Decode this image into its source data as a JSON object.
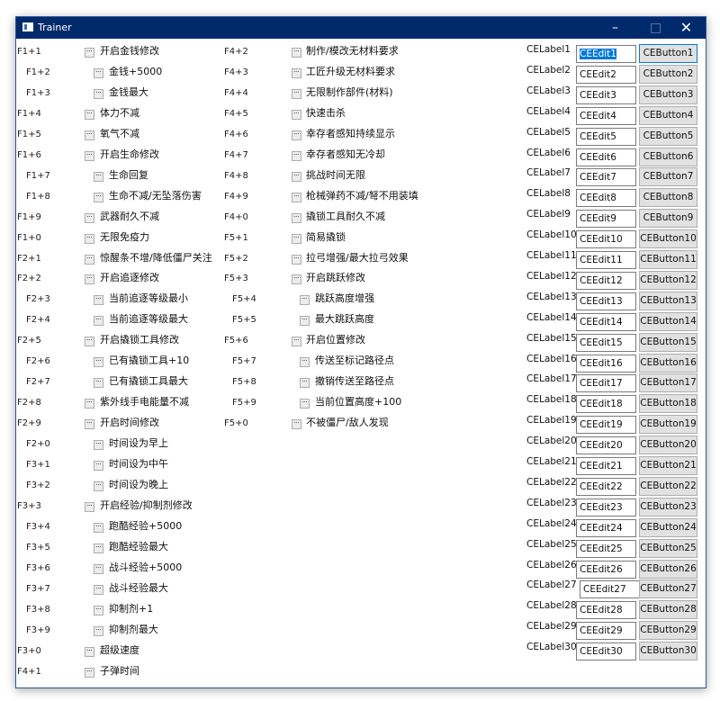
{
  "window": {
    "title": "Trainer",
    "minimize_glyph": "–",
    "maximize_glyph": "□",
    "close_glyph": "✕"
  },
  "col1": [
    {
      "hotkey": "F1+1",
      "label": "开启金钱修改",
      "sub": false
    },
    {
      "hotkey": "F1+2",
      "label": "金钱+5000",
      "sub": true
    },
    {
      "hotkey": "F1+3",
      "label": "金钱最大",
      "sub": true
    },
    {
      "hotkey": "F1+4",
      "label": "体力不减",
      "sub": false
    },
    {
      "hotkey": "F1+5",
      "label": "氧气不减",
      "sub": false
    },
    {
      "hotkey": "F1+6",
      "label": "开启生命修改",
      "sub": false
    },
    {
      "hotkey": "F1+7",
      "label": "生命回复",
      "sub": true
    },
    {
      "hotkey": "F1+8",
      "label": "生命不减/无坠落伤害",
      "sub": true
    },
    {
      "hotkey": "F1+9",
      "label": "武器耐久不减",
      "sub": false
    },
    {
      "hotkey": "F1+0",
      "label": "无限免疫力",
      "sub": false
    },
    {
      "hotkey": "F2+1",
      "label": "惊醒条不增/降低僵尸关注",
      "sub": false
    },
    {
      "hotkey": "F2+2",
      "label": "开启追逐修改",
      "sub": false
    },
    {
      "hotkey": "F2+3",
      "label": "当前追逐等级最小",
      "sub": true
    },
    {
      "hotkey": "F2+4",
      "label": "当前追逐等级最大",
      "sub": true
    },
    {
      "hotkey": "F2+5",
      "label": "开启撬锁工具修改",
      "sub": false
    },
    {
      "hotkey": "F2+6",
      "label": "已有撬锁工具+10",
      "sub": true
    },
    {
      "hotkey": "F2+7",
      "label": "已有撬锁工具最大",
      "sub": true
    },
    {
      "hotkey": "F2+8",
      "label": "紫外线手电能量不减",
      "sub": false
    },
    {
      "hotkey": "F2+9",
      "label": "开启时间修改",
      "sub": false
    },
    {
      "hotkey": "F2+0",
      "label": "时间设为早上",
      "sub": true
    },
    {
      "hotkey": "F3+1",
      "label": "时间设为中午",
      "sub": true
    },
    {
      "hotkey": "F3+2",
      "label": "时间设为晚上",
      "sub": true
    },
    {
      "hotkey": "F3+3",
      "label": "开启经验/抑制剂修改",
      "sub": false
    },
    {
      "hotkey": "F3+4",
      "label": "跑酷经验+5000",
      "sub": true
    },
    {
      "hotkey": "F3+5",
      "label": "跑酷经验最大",
      "sub": true
    },
    {
      "hotkey": "F3+6",
      "label": "战斗经验+5000",
      "sub": true
    },
    {
      "hotkey": "F3+7",
      "label": "战斗经验最大",
      "sub": true
    },
    {
      "hotkey": "F3+8",
      "label": "抑制剂+1",
      "sub": true
    },
    {
      "hotkey": "F3+9",
      "label": "抑制剂最大",
      "sub": true
    },
    {
      "hotkey": "F3+0",
      "label": "超级速度",
      "sub": false
    },
    {
      "hotkey": "F4+1",
      "label": "子弹时间",
      "sub": false
    }
  ],
  "col2": [
    {
      "hotkey": "F4+2",
      "label": "制作/模改无材料要求",
      "sub": false
    },
    {
      "hotkey": "F4+3",
      "label": "工匠升级无材料要求",
      "sub": false
    },
    {
      "hotkey": "F4+4",
      "label": "无限制作部件(材料)",
      "sub": false
    },
    {
      "hotkey": "F4+5",
      "label": "快速击杀",
      "sub": false
    },
    {
      "hotkey": "F4+6",
      "label": "幸存者感知持续显示",
      "sub": false
    },
    {
      "hotkey": "F4+7",
      "label": "幸存者感知无冷却",
      "sub": false
    },
    {
      "hotkey": "F4+8",
      "label": "挑战时间无限",
      "sub": false
    },
    {
      "hotkey": "F4+9",
      "label": "枪械弹药不减/弩不用装填",
      "sub": false
    },
    {
      "hotkey": "F4+0",
      "label": "撬锁工具耐久不减",
      "sub": false
    },
    {
      "hotkey": "F5+1",
      "label": "简易撬锁",
      "sub": false
    },
    {
      "hotkey": "F5+2",
      "label": "拉弓增强/最大拉弓效果",
      "sub": false
    },
    {
      "hotkey": "F5+3",
      "label": "开启跳跃修改",
      "sub": false
    },
    {
      "hotkey": "F5+4",
      "label": "跳跃高度增强",
      "sub": true
    },
    {
      "hotkey": "F5+5",
      "label": "最大跳跃高度",
      "sub": true
    },
    {
      "hotkey": "F5+6",
      "label": "开启位置修改",
      "sub": false
    },
    {
      "hotkey": "F5+7",
      "label": "传送至标记路径点",
      "sub": true
    },
    {
      "hotkey": "F5+8",
      "label": "撤销传送至路径点",
      "sub": true
    },
    {
      "hotkey": "F5+9",
      "label": "当前位置高度+100",
      "sub": true
    },
    {
      "hotkey": "F5+0",
      "label": "不被僵尸/敌人发现",
      "sub": false
    }
  ],
  "ce_rows": [
    {
      "label": "CELabel1",
      "edit": "CEEdit1",
      "button": "CEButton1"
    },
    {
      "label": "CELabel2",
      "edit": "CEEdit2",
      "button": "CEButton2"
    },
    {
      "label": "CELabel3",
      "edit": "CEEdit3",
      "button": "CEButton3"
    },
    {
      "label": "CELabel4",
      "edit": "CEEdit4",
      "button": "CEButton4"
    },
    {
      "label": "CELabel5",
      "edit": "CEEdit5",
      "button": "CEButton5"
    },
    {
      "label": "CELabel6",
      "edit": "CEEdit6",
      "button": "CEButton6"
    },
    {
      "label": "CELabel7",
      "edit": "CEEdit7",
      "button": "CEButton7"
    },
    {
      "label": "CELabel8",
      "edit": "CEEdit8",
      "button": "CEButton8"
    },
    {
      "label": "CELabel9",
      "edit": "CEEdit9",
      "button": "CEButton9"
    },
    {
      "label": "CELabel10",
      "edit": "CEEdit10",
      "button": "CEButton10"
    },
    {
      "label": "CELabel11",
      "edit": "CEEdit11",
      "button": "CEButton11"
    },
    {
      "label": "CELabel12",
      "edit": "CEEdit12",
      "button": "CEButton12"
    },
    {
      "label": "CELabel13",
      "edit": "CEEdit13",
      "button": "CEButton13"
    },
    {
      "label": "CELabel14",
      "edit": "CEEdit14",
      "button": "CEButton14"
    },
    {
      "label": "CELabel15",
      "edit": "CEEdit15",
      "button": "CEButton15"
    },
    {
      "label": "CELabel16",
      "edit": "CEEdit16",
      "button": "CEButton16"
    },
    {
      "label": "CELabel17",
      "edit": "CEEdit17",
      "button": "CEButton17"
    },
    {
      "label": "CELabel18",
      "edit": "CEEdit18",
      "button": "CEButton18"
    },
    {
      "label": "CELabel19",
      "edit": "CEEdit19",
      "button": "CEButton19"
    },
    {
      "label": "CELabel20",
      "edit": "CEEdit20",
      "button": "CEButton20"
    },
    {
      "label": "CELabel21",
      "edit": "CEEdit21",
      "button": "CEButton21"
    },
    {
      "label": "CELabel22",
      "edit": "CEEdit22",
      "button": "CEButton22"
    },
    {
      "label": "CELabel23",
      "edit": "CEEdit23",
      "button": "CEButton23"
    },
    {
      "label": "CELabel24",
      "edit": "CEEdit24",
      "button": "CEButton24"
    },
    {
      "label": "CELabel25",
      "edit": "CEEdit25",
      "button": "CEButton25"
    },
    {
      "label": "CELabel26",
      "edit": "CEEdit26",
      "button": "CEButton26"
    },
    {
      "label": "CELabel27",
      "edit": "CEEdit27",
      "button": "CEButton27"
    },
    {
      "label": "CELabel28",
      "edit": "CEEdit28",
      "button": "CEButton28"
    },
    {
      "label": "CELabel29",
      "edit": "CEEdit29",
      "button": "CEButton29"
    },
    {
      "label": "CELabel30",
      "edit": "CEEdit30",
      "button": "CEButton30"
    }
  ]
}
